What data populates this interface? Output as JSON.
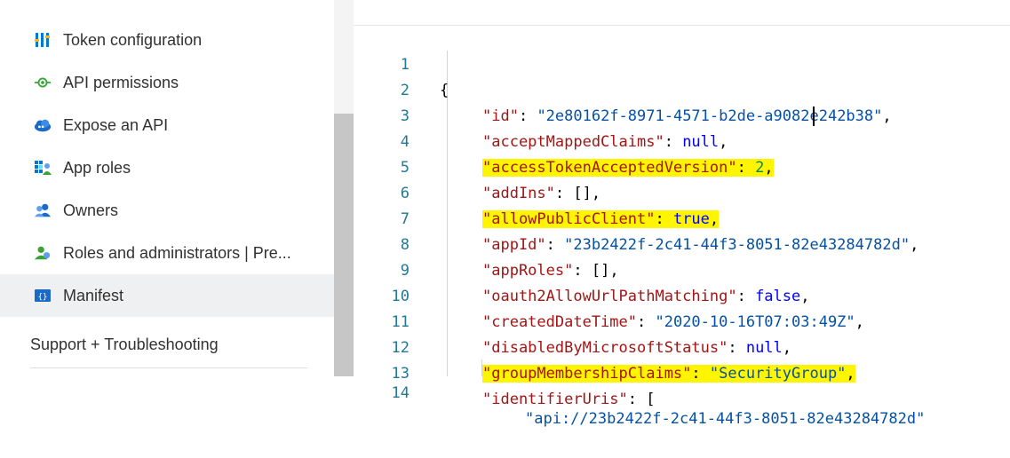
{
  "sidebar": {
    "items": [
      {
        "label": "Token configuration",
        "icon": "token-config-icon"
      },
      {
        "label": "API permissions",
        "icon": "api-permissions-icon"
      },
      {
        "label": "Expose an API",
        "icon": "cloud-icon"
      },
      {
        "label": "App roles",
        "icon": "app-roles-icon"
      },
      {
        "label": "Owners",
        "icon": "owners-icon"
      },
      {
        "label": "Roles and administrators | Pre...",
        "icon": "roles-admin-icon"
      },
      {
        "label": "Manifest",
        "icon": "manifest-icon",
        "selected": true
      }
    ],
    "section_header": "Support + Troubleshooting"
  },
  "editor": {
    "line_numbers": [
      "1",
      "2",
      "3",
      "4",
      "5",
      "6",
      "7",
      "8",
      "9",
      "10",
      "11",
      "12",
      "13",
      "14"
    ],
    "lines": {
      "l1": "{",
      "l2_key": "\"id\"",
      "l2_val": "\"2e80162f-8971-4571-b2de-a9082e242b38\"",
      "l3_key": "\"acceptMappedClaims\"",
      "l3_val": "null",
      "l4_key": "\"accessTokenAcceptedVersion\"",
      "l4_val": "2",
      "l5_key": "\"addIns\"",
      "l5_val": "[]",
      "l6_key": "\"allowPublicClient\"",
      "l6_val": "true",
      "l7_key": "\"appId\"",
      "l7_val": "\"23b2422f-2c41-44f3-8051-82e43284782d\"",
      "l8_key": "\"appRoles\"",
      "l8_val": "[]",
      "l9_key": "\"oauth2AllowUrlPathMatching\"",
      "l9_val": "false",
      "l10_key": "\"createdDateTime\"",
      "l10_val": "\"2020-10-16T07:03:49Z\"",
      "l11_key": "\"disabledByMicrosoftStatus\"",
      "l11_val": "null",
      "l12_key": "\"groupMembershipClaims\"",
      "l12_val": "\"SecurityGroup\"",
      "l13_key": "\"identifierUris\"",
      "l13_val": "[",
      "l14_val": "\"api://23b2422f-2c41-44f3-8051-82e43284782d\""
    },
    "highlight_color": "#fff500"
  },
  "colors": {
    "key": "#a31515",
    "string": "#0451a5",
    "keyword": "#0000ff",
    "number": "#098658",
    "line_number": "#237893"
  }
}
